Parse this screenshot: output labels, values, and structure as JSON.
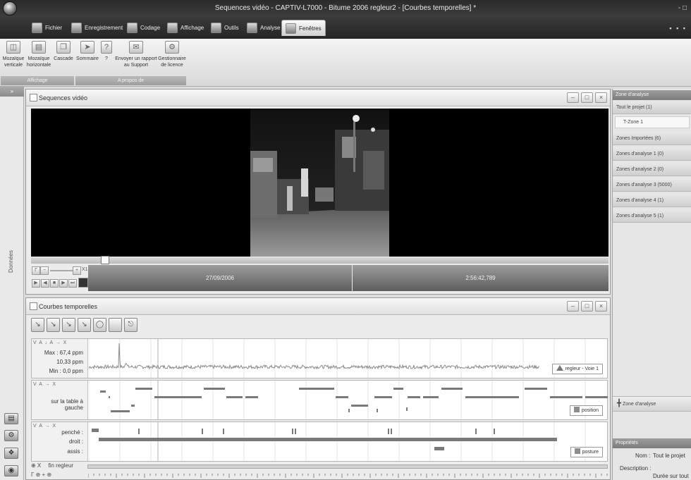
{
  "window": {
    "title": "Sequences vidéo - CAPTIV-L7000 - Bitume 2006 regleur2 - [Courbes temporelles] *",
    "controls": "- □"
  },
  "menu": {
    "tabs": [
      {
        "label": "Fichier"
      },
      {
        "label": "Enregistrement"
      },
      {
        "label": "Codage"
      },
      {
        "label": "Affichage"
      },
      {
        "label": "Outils"
      },
      {
        "label": "Analyse"
      },
      {
        "label": "Fenêtres"
      }
    ],
    "right_controls": "▪ ▪ ▪"
  },
  "ribbon": {
    "buttons": [
      {
        "label": "Mozaïque\nverticale"
      },
      {
        "label": "Mozaïque\nhorizontale"
      },
      {
        "label": "Cascade"
      },
      {
        "label": "Sommaire"
      },
      {
        "label": "?"
      },
      {
        "label": "Envoyer un rapport\nau Support"
      },
      {
        "label": "Gestionnaire\nde licence"
      }
    ],
    "groups": {
      "affichage": "Affichage",
      "apropos": "A propos de"
    }
  },
  "left_strip": {
    "label": "Données",
    "collapse": "»"
  },
  "video": {
    "title": "Sequences vidéo",
    "speed": "X1",
    "date": "27/09/2006",
    "time": "2:56:42,789"
  },
  "curves": {
    "title": "Courbes temporelles",
    "track1": {
      "tools": "V A ↓ A → X",
      "max": "Max : 67,4 ppm",
      "current": "10,33 ppm",
      "min": "Min : 0,0 ppm",
      "legend": "regleur - Voie 1"
    },
    "track2": {
      "tools": "V A → X",
      "label": "sur la table à gauche",
      "legend": "position"
    },
    "track3": {
      "tools": "V A → X",
      "labels": [
        "penché :",
        "droit :",
        "assis :"
      ],
      "legend": "posture"
    },
    "fin_label": "fin regleur",
    "fin_tools": "⊕ X",
    "bottom_tools": "Γ ⊕ + ⊕"
  },
  "right_panel": {
    "header": "Zone d'analyse",
    "tout_projet": "Tout le projet (1)",
    "tzone": "T-Zone 1",
    "zones": [
      "Zones Importées (6)",
      "Zones d'analyse 1 (0)",
      "Zones d'analyse 2 (0)",
      "Zones d'analyse 3 (5000)",
      "Zones d'analyse 4 (1)",
      "Zones d'analyse 5 (1)"
    ],
    "zone_tool": "Zone d'analyse",
    "properties_header": "Propriétés",
    "nom_label": "Nom :",
    "nom_value": "Tout le projet",
    "description_label": "Description :",
    "description_value": "Durée sur tout le"
  },
  "colors": {
    "segment": "#7a7a7a",
    "signal": "#8a8a8a",
    "header_dark": "#2f2f2f"
  }
}
